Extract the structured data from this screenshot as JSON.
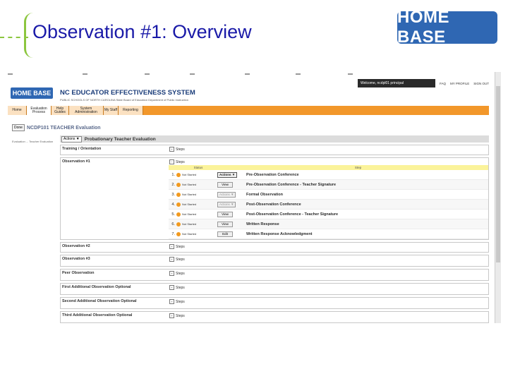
{
  "slide": {
    "title": "Observation #1:  Overview",
    "logo_text": "HOME BASE"
  },
  "app": {
    "welcome": "Welcome, ncdpl01 principal",
    "links": [
      "FAQ",
      "MY PROFILE",
      "SIGN OUT"
    ],
    "logo_text": "HOME BASE",
    "system_name": "NC EDUCATOR EFFECTIVENESS SYSTEM",
    "system_sub": "PUBLIC SCHOOLS OF NORTH CAROLINA  State Board of Education  Department of Public Instruction",
    "nav_tabs": [
      "Home",
      "Evaluation Process",
      "Help Guides",
      "System Administration",
      "My Staff",
      "Reporting"
    ]
  },
  "breadcrumb": {
    "done_label": "Done",
    "title": "NCDP101 TEACHER Evaluation"
  },
  "left_note": "Evaluation ... Teacher Evaluation",
  "evaluation": {
    "actions_label": "Actions ▼",
    "title": "Probationary Teacher Evaluation",
    "steps_label": "Steps",
    "rows": [
      {
        "label": "Training / Orientation"
      },
      {
        "label": "Observation #1"
      },
      {
        "label": "Observation #2"
      },
      {
        "label": "Observation #3"
      },
      {
        "label": "Peer Observation"
      },
      {
        "label": "First Additional Observation    Optional"
      },
      {
        "label": "Second Additional Observation    Optional"
      },
      {
        "label": "Third Additional Observation    Optional"
      }
    ],
    "table_headers": {
      "status": "Status",
      "step": "Step"
    },
    "steps": [
      {
        "num": "1.",
        "status": "Not Started",
        "button": "Actions ▼",
        "name": "Pre-Observation Conference"
      },
      {
        "num": "2.",
        "status": "Not Started",
        "button": "View",
        "name": "Pre-Observation Conference - Teacher Signature"
      },
      {
        "num": "3.",
        "status": "Not Started",
        "button": "Actions ▼",
        "name": "Formal Observation"
      },
      {
        "num": "4.",
        "status": "Not Started",
        "button": "Actions ▼",
        "name": "Post-Observation Conference"
      },
      {
        "num": "5.",
        "status": "Not Started",
        "button": "View",
        "name": "Post-Observation Conference - Teacher Signature"
      },
      {
        "num": "6.",
        "status": "Not Started",
        "button": "View",
        "name": "Written Response"
      },
      {
        "num": "7.",
        "status": "Not Started",
        "button": "Edit",
        "name": "Written Response Acknowledgment"
      }
    ]
  }
}
